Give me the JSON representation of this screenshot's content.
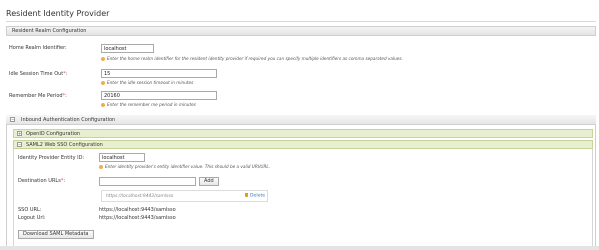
{
  "page": {
    "title": "Resident Identity Provider"
  },
  "realm": {
    "section_title": "Resident Realm Configuration",
    "home_realm": {
      "label": "Home Realm Identifier:",
      "value": "localhost",
      "help": "Enter the home realm identifier for the resident identity provider if required you can specify multiple identifiers as comma separated values."
    },
    "idle_timeout": {
      "label": "Idle Session Time Out",
      "required_mark": "*",
      "label_suffix": ":",
      "value": "15",
      "help": "Enter the idle session timeout in minutes"
    },
    "remember_me": {
      "label": "Remember Me Period",
      "required_mark": "*",
      "label_suffix": ":",
      "value": "20160",
      "help": "Enter the remember me period in minutes"
    }
  },
  "inbound": {
    "title": "Inbound Authentication Configuration",
    "toggle_symbol": "−",
    "openid": {
      "title": "OpenID Configuration",
      "toggle_symbol": "+"
    },
    "saml": {
      "title": "SAML2 Web SSO Configuration",
      "toggle_symbol": "−",
      "entity_id": {
        "label": "Identity Provider Entity ID:",
        "value": "localhost",
        "help": "Enter identity provider's entity identifier value. This should be a valid URI/URL."
      },
      "destination": {
        "label": "Destination URLs",
        "required_mark": "*",
        "label_suffix": ":",
        "input_value": "",
        "add_label": "Add",
        "urls": [
          "https://localhost:9443/samlsso"
        ],
        "delete_label": "Delete"
      },
      "sso_url": {
        "label": "SSO URL:",
        "value": "https://localhost:9443/samlsso"
      },
      "logout_url": {
        "label": "Logout Url:",
        "value": "https://localhost:9443/samlsso"
      },
      "download_label": "Download SAML Metadata"
    }
  },
  "colors": {
    "subsection_bg": "#e8efd0",
    "help_icon": "#f0ad4e",
    "link": "#3a78c2",
    "required": "#d9534f"
  }
}
